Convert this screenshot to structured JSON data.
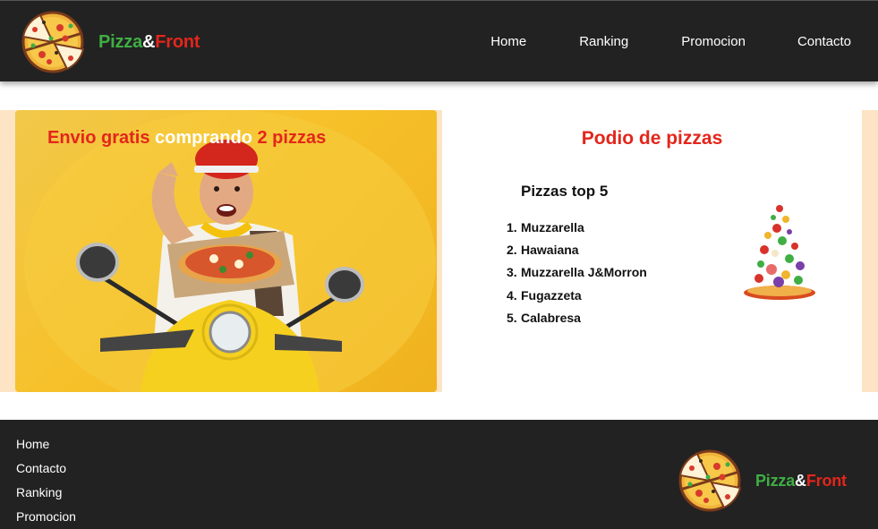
{
  "header": {
    "logo_icon": "pizza-slices-icon",
    "brand": {
      "part1": "Pizza",
      "amp": "&",
      "part2": "Front"
    },
    "nav": {
      "home": "Home",
      "ranking": "Ranking",
      "promocion": "Promocion",
      "contacto": "Contacto"
    }
  },
  "promo": {
    "title_part1": "Envio gratis ",
    "title_part2": "comprando",
    "title_part3": " 2 pizzas",
    "image": "delivery-man-scooter-pizza-photo"
  },
  "podium": {
    "title": "Podio de pizzas",
    "list_title": "Pizzas top 5",
    "items": [
      {
        "n": "1.",
        "name": "Muzzarella"
      },
      {
        "n": "2.",
        "name": "Hawaiana"
      },
      {
        "n": "3.",
        "name": "Muzzarella J&Morron"
      },
      {
        "n": "4.",
        "name": "Fugazzeta"
      },
      {
        "n": "5.",
        "name": "Calabresa"
      }
    ],
    "image": "flying-ingredients-pizza-icon"
  },
  "footer": {
    "links": {
      "home": "Home",
      "contacto": "Contacto",
      "ranking": "Ranking",
      "promocion": "Promocion"
    },
    "brand": {
      "part1": "Pizza",
      "amp": "&",
      "part2": "Front"
    }
  },
  "colors": {
    "header_bg": "#222222",
    "brand_green": "#3fae44",
    "brand_red": "#e3261b",
    "band_bg": "#fde4c4",
    "promo_yellow": "#f6c12a"
  }
}
